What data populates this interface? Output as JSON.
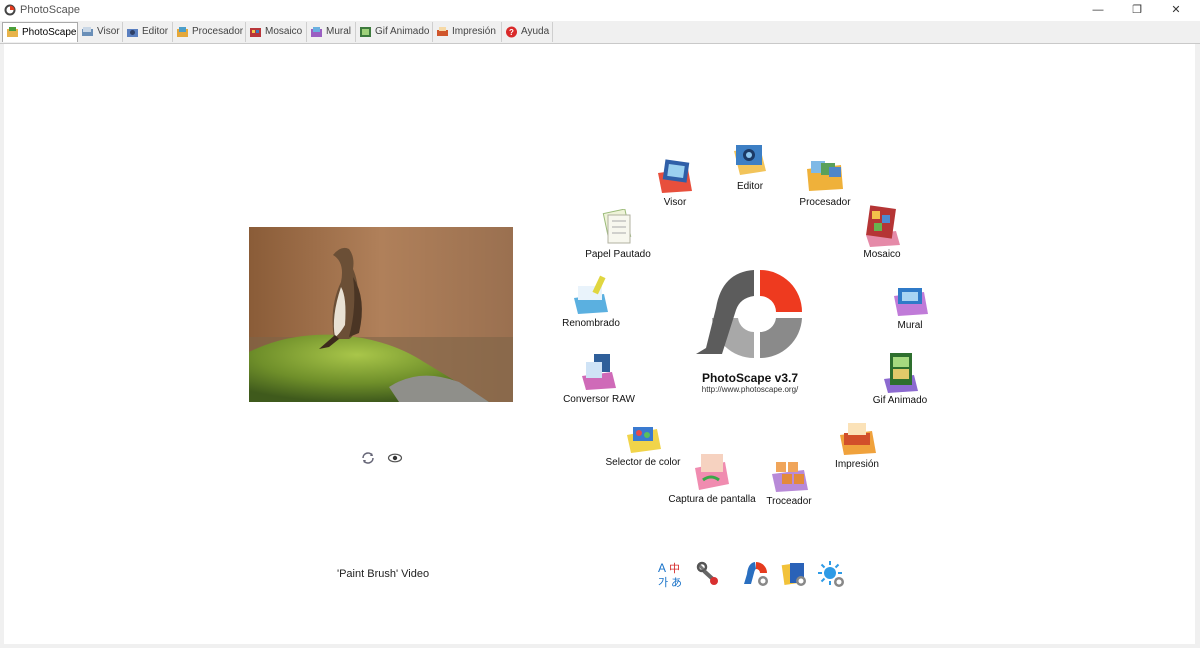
{
  "window": {
    "title": "PhotoScape",
    "minimize": "—",
    "restore": "❐",
    "close": "✕"
  },
  "tabs": [
    {
      "label": "PhotoScape",
      "active": true
    },
    {
      "label": "Visor"
    },
    {
      "label": "Editor"
    },
    {
      "label": "Procesador"
    },
    {
      "label": "Mosaico"
    },
    {
      "label": "Mural"
    },
    {
      "label": "Gif Animado"
    },
    {
      "label": "Impresión"
    },
    {
      "label": "Ayuda"
    }
  ],
  "preview": {
    "video_link": "'Paint Brush' Video",
    "refresh_icon": "refresh-icon",
    "view_icon": "eye-icon"
  },
  "tools": [
    {
      "label": "Editor",
      "icon": "editor-icon"
    },
    {
      "label": "Procesador",
      "icon": "processor-icon"
    },
    {
      "label": "Mosaico",
      "icon": "mosaic-icon"
    },
    {
      "label": "Mural",
      "icon": "mural-icon"
    },
    {
      "label": "Gif Animado",
      "icon": "gif-icon"
    },
    {
      "label": "Impresión",
      "icon": "print-icon"
    },
    {
      "label": "Troceador",
      "icon": "splitter-icon"
    },
    {
      "label": "Captura de pantalla",
      "icon": "screen-capture-icon"
    },
    {
      "label": "Selector de color",
      "icon": "color-picker-icon"
    },
    {
      "label": "Conversor RAW",
      "icon": "raw-converter-icon"
    },
    {
      "label": "Renombrado",
      "icon": "rename-icon"
    },
    {
      "label": "Papel Pautado",
      "icon": "page-icon"
    },
    {
      "label": "Visor",
      "icon": "viewer-icon"
    }
  ],
  "center": {
    "version": "PhotoScape v3.7",
    "url": "http://www.photoscape.org/"
  },
  "bottom_icons": [
    "language-icon",
    "tools-icon",
    "photoscape-x-icon",
    "slideshow-icon",
    "brightness-icon"
  ],
  "colors": {
    "logo_red": "#ee3a1f",
    "logo_grey": "#666666"
  }
}
